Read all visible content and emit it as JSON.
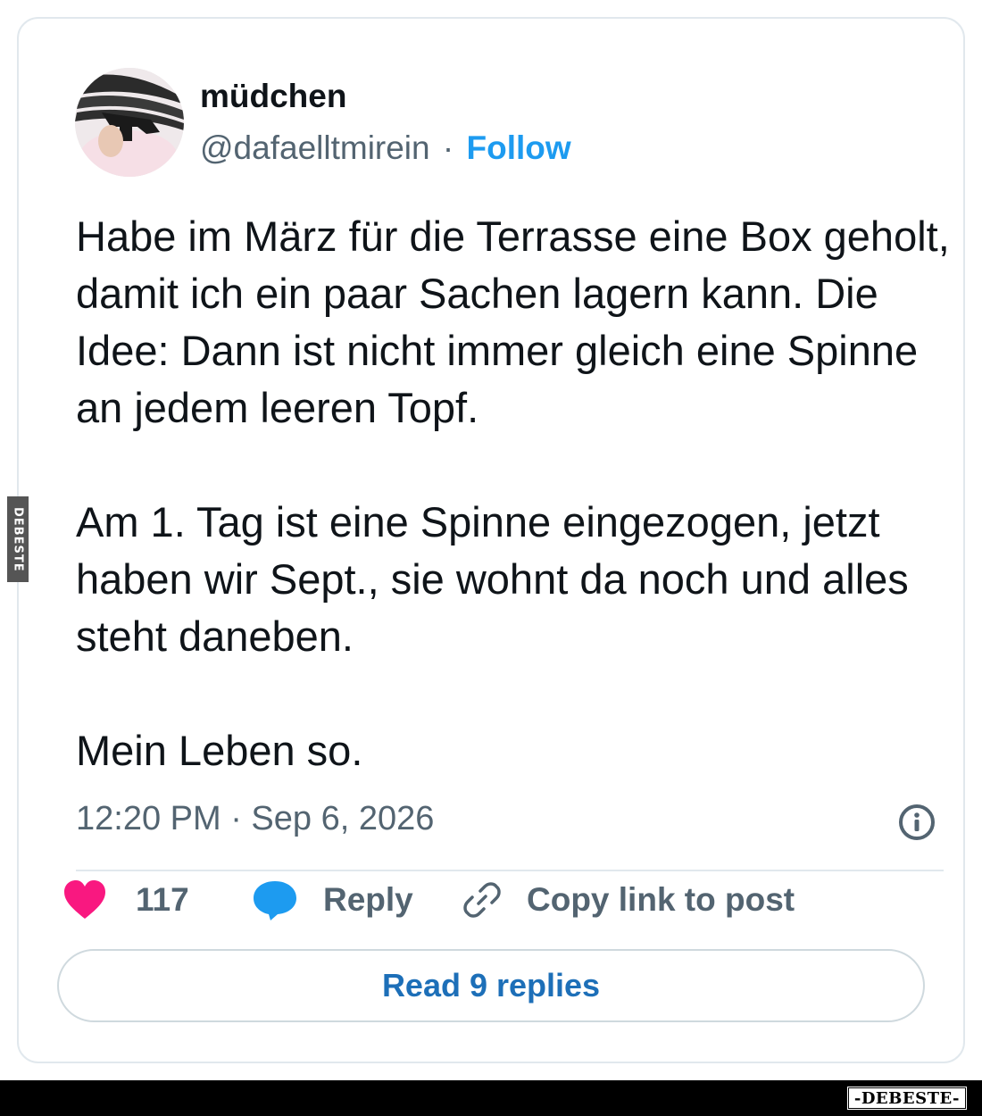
{
  "author": {
    "name": "müdchen",
    "handle": "@dafaelltmirein",
    "separator": "·",
    "follow_label": "Follow"
  },
  "tweet": {
    "paragraphs": [
      "Habe im März für die Terrasse eine Box geholt, damit ich ein paar Sachen lagern kann. Die Idee: Dann ist nicht immer gleich eine Spinne an jedem leeren Topf.",
      "Am 1. Tag ist eine Spinne eingezogen, jetzt haben wir Sept., sie wohnt da noch und alles steht daneben.",
      "Mein Leben so."
    ],
    "timestamp": "12:20 PM · Sep 6, 2026"
  },
  "actions": {
    "like_count": "117",
    "reply_label": "Reply",
    "copy_link_label": "Copy link to post"
  },
  "read_replies_label": "Read 9 replies",
  "watermarks": {
    "side": "DEBESTE",
    "bottom": "-DEBESTE-"
  },
  "icons": {
    "like": "heart-icon",
    "reply": "speech-bubble-icon",
    "copy": "link-icon",
    "info": "info-icon"
  },
  "colors": {
    "heart": "#f91880",
    "reply_bubble": "#1d9bf0",
    "follow": "#1d9bf0",
    "read_replies": "#1d6fb8",
    "muted_text": "#536471",
    "border": "#e1e8ed"
  }
}
